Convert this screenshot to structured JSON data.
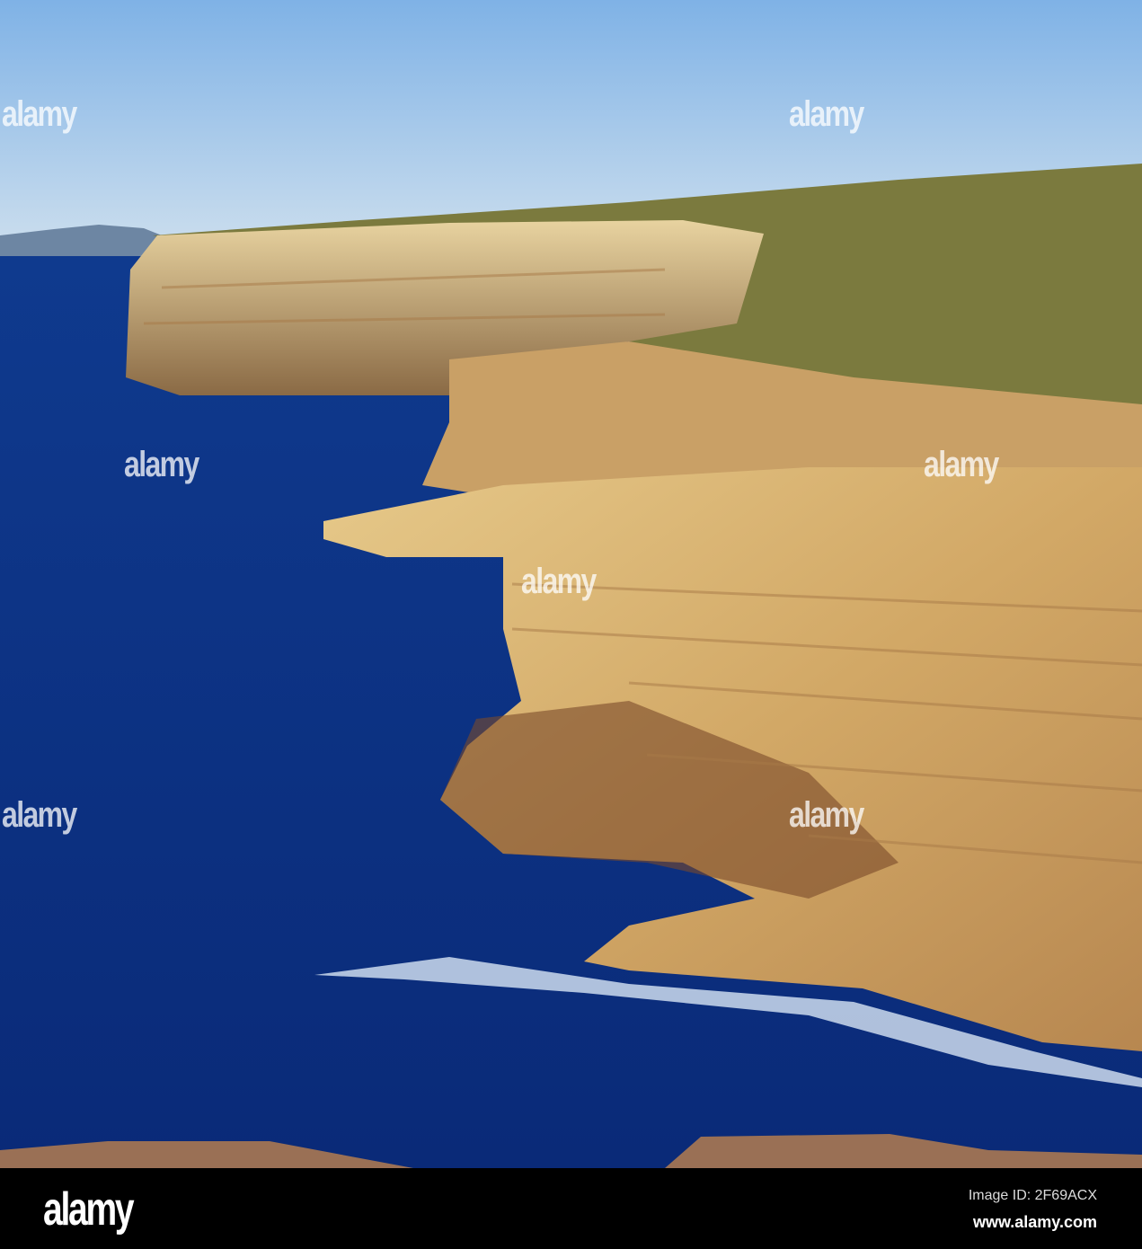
{
  "watermark": "alamy",
  "footer": {
    "logo": "alamy",
    "image_id": "Image ID: 2F69ACX",
    "url": "www.alamy.com"
  }
}
